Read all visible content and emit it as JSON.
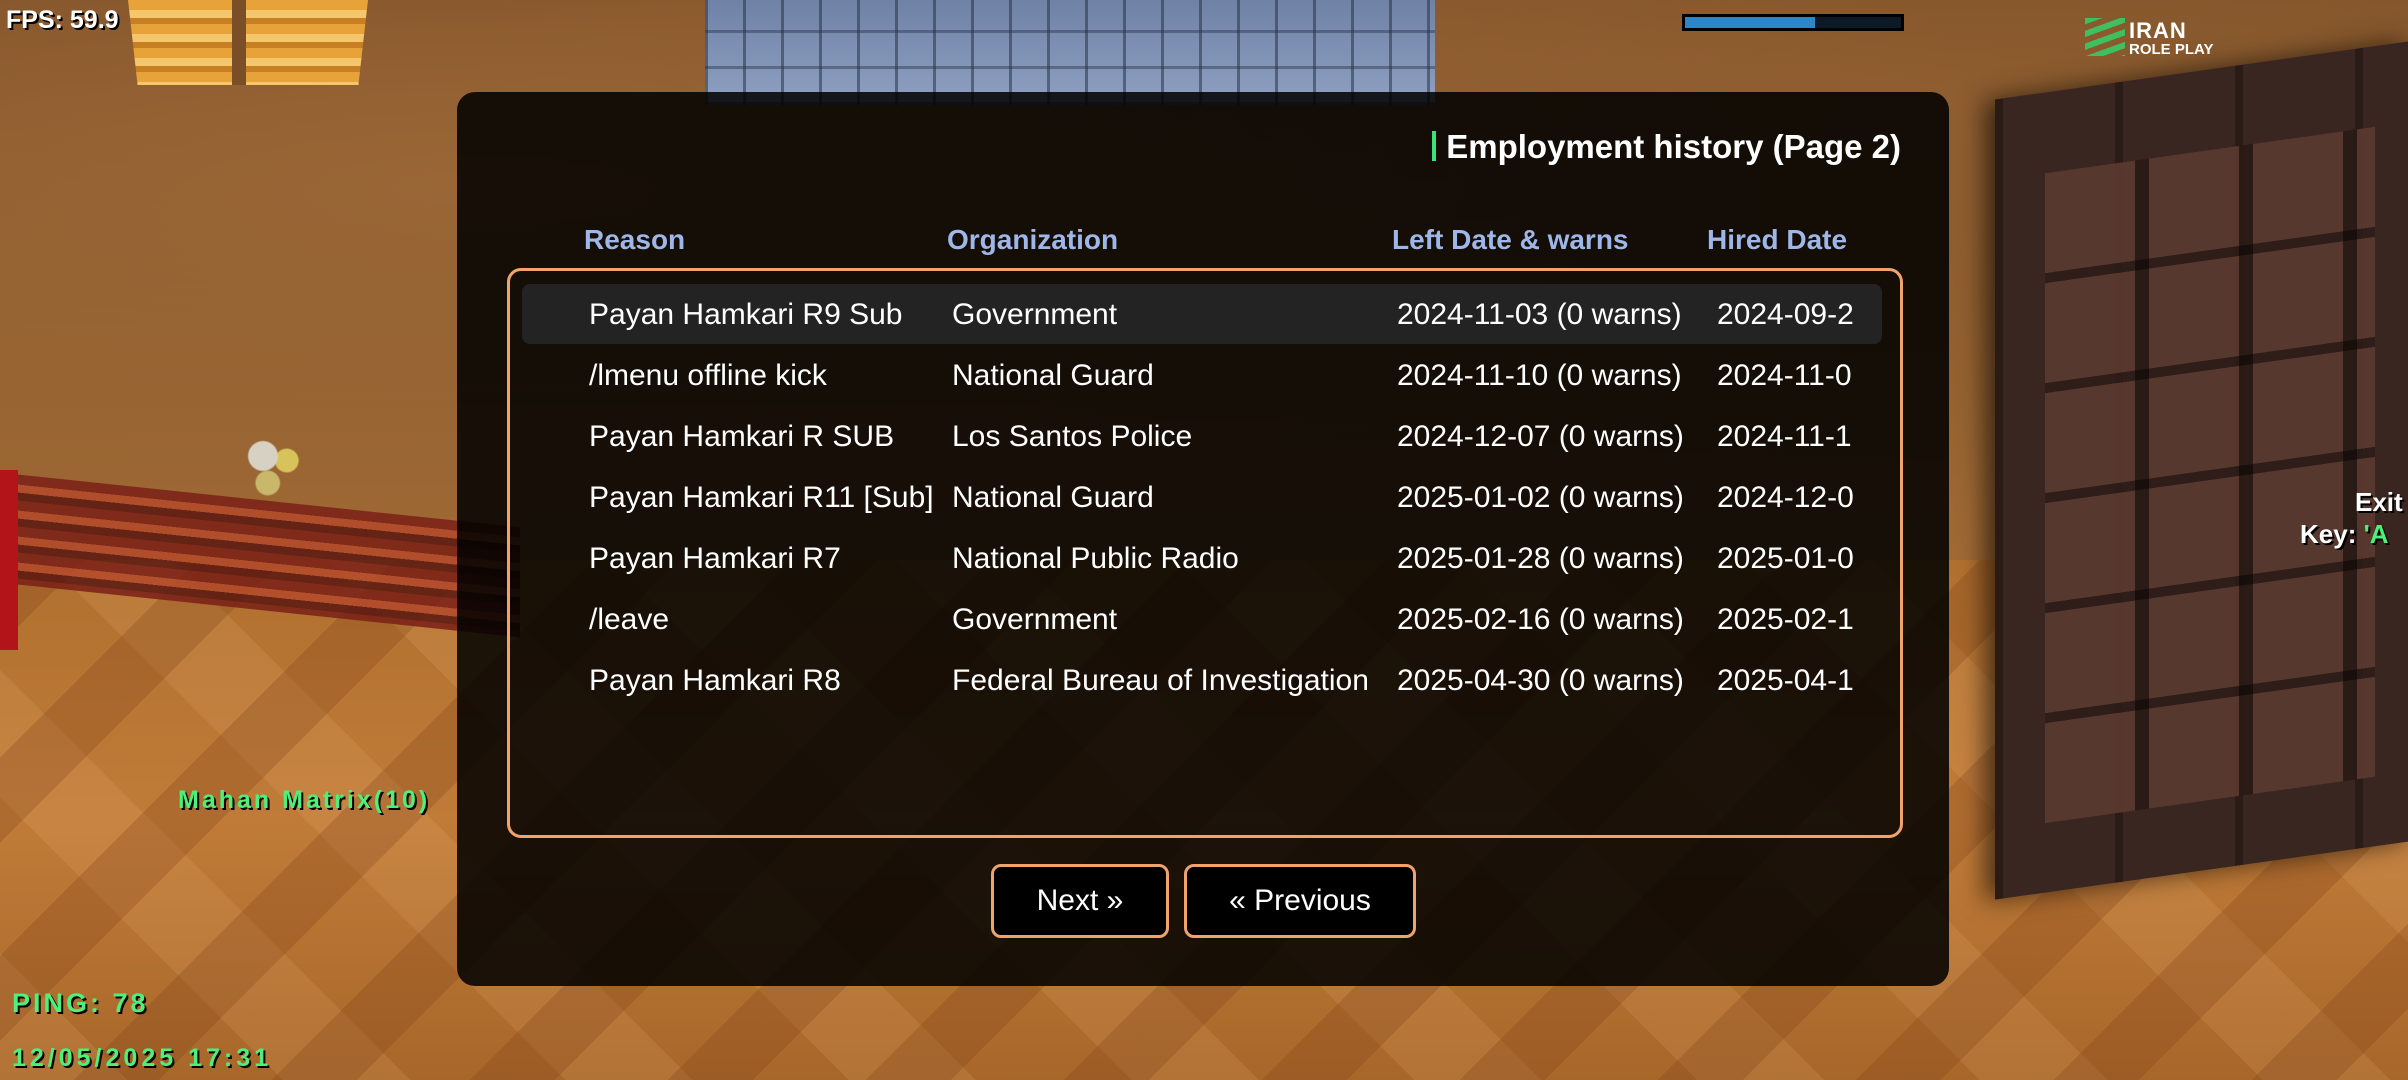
{
  "hud": {
    "fps": "FPS: 59.9",
    "health_fraction": 0.6,
    "logo_line1": "IRAN",
    "logo_line2": "ROLE PLAY",
    "player_name": "Mahan Matrix(10)",
    "ping": "PING: 78",
    "datetime": "12/05/2025 17:31",
    "exit_label": "Exit",
    "key_label": "Key: ",
    "key_value": "'A"
  },
  "dialog": {
    "title": "Employment history (Page 2)",
    "columns": {
      "reason": "Reason",
      "organization": "Organization",
      "left": "Left Date & warns",
      "hired": "Hired Date"
    },
    "rows": [
      {
        "reason": "Payan Hamkari R9 Sub",
        "organization": "Government",
        "left": "2024-11-03 (0 warns)",
        "hired": "2024-09-2"
      },
      {
        "reason": "/lmenu offline kick",
        "organization": "National Guard",
        "left": "2024-11-10 (0 warns)",
        "hired": "2024-11-0"
      },
      {
        "reason": "Payan Hamkari R SUB",
        "organization": "Los Santos Police",
        "left": "2024-12-07 (0 warns)",
        "hired": "2024-11-1"
      },
      {
        "reason": "Payan Hamkari R11 [Sub]",
        "organization": "National Guard",
        "left": "2025-01-02 (0 warns)",
        "hired": "2024-12-0"
      },
      {
        "reason": "Payan Hamkari R7",
        "organization": "National Public Radio",
        "left": "2025-01-28 (0 warns)",
        "hired": "2025-01-0"
      },
      {
        "reason": "/leave",
        "organization": "Government",
        "left": "2025-02-16 (0 warns)",
        "hired": "2025-02-1"
      },
      {
        "reason": "Payan Hamkari R8",
        "organization": "Federal Bureau of Investigation",
        "left": "2025-04-30 (0 warns)",
        "hired": "2025-04-1"
      }
    ],
    "selected_row": 0,
    "next_label": "Next »",
    "prev_label": "« Previous"
  },
  "colors": {
    "accent_border": "#f0a46c",
    "header_text": "#9fb6e8",
    "hud_green": "#4cf07a",
    "title_bar": "#3ee07a"
  }
}
